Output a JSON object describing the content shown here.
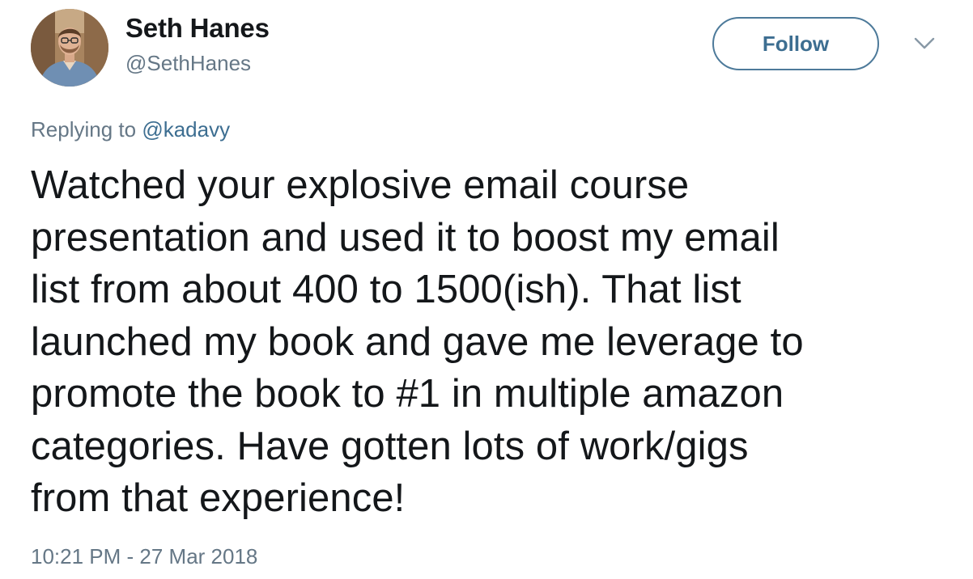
{
  "author": {
    "name": "Seth Hanes",
    "handle": "@SethHanes"
  },
  "follow_button": {
    "label": "Follow"
  },
  "menu": {
    "icon": "chevron-down-icon"
  },
  "reply": {
    "prefix": "Replying to",
    "mention": "@kadavy"
  },
  "tweet": {
    "lines": [
      "Watched your explosive email course",
      "presentation and used it to boost my email",
      "list from about 400 to 1500(ish). That list",
      "launched my book and gave me leverage to",
      "promote the book to #1 in multiple amazon",
      "categories. Have gotten lots of work/gigs",
      "from that experience!"
    ],
    "timestamp": "10:21 PM - 27 Mar 2018"
  },
  "colors": {
    "text": "#14171a",
    "secondary": "#657786",
    "accent": "#3d6e91"
  }
}
